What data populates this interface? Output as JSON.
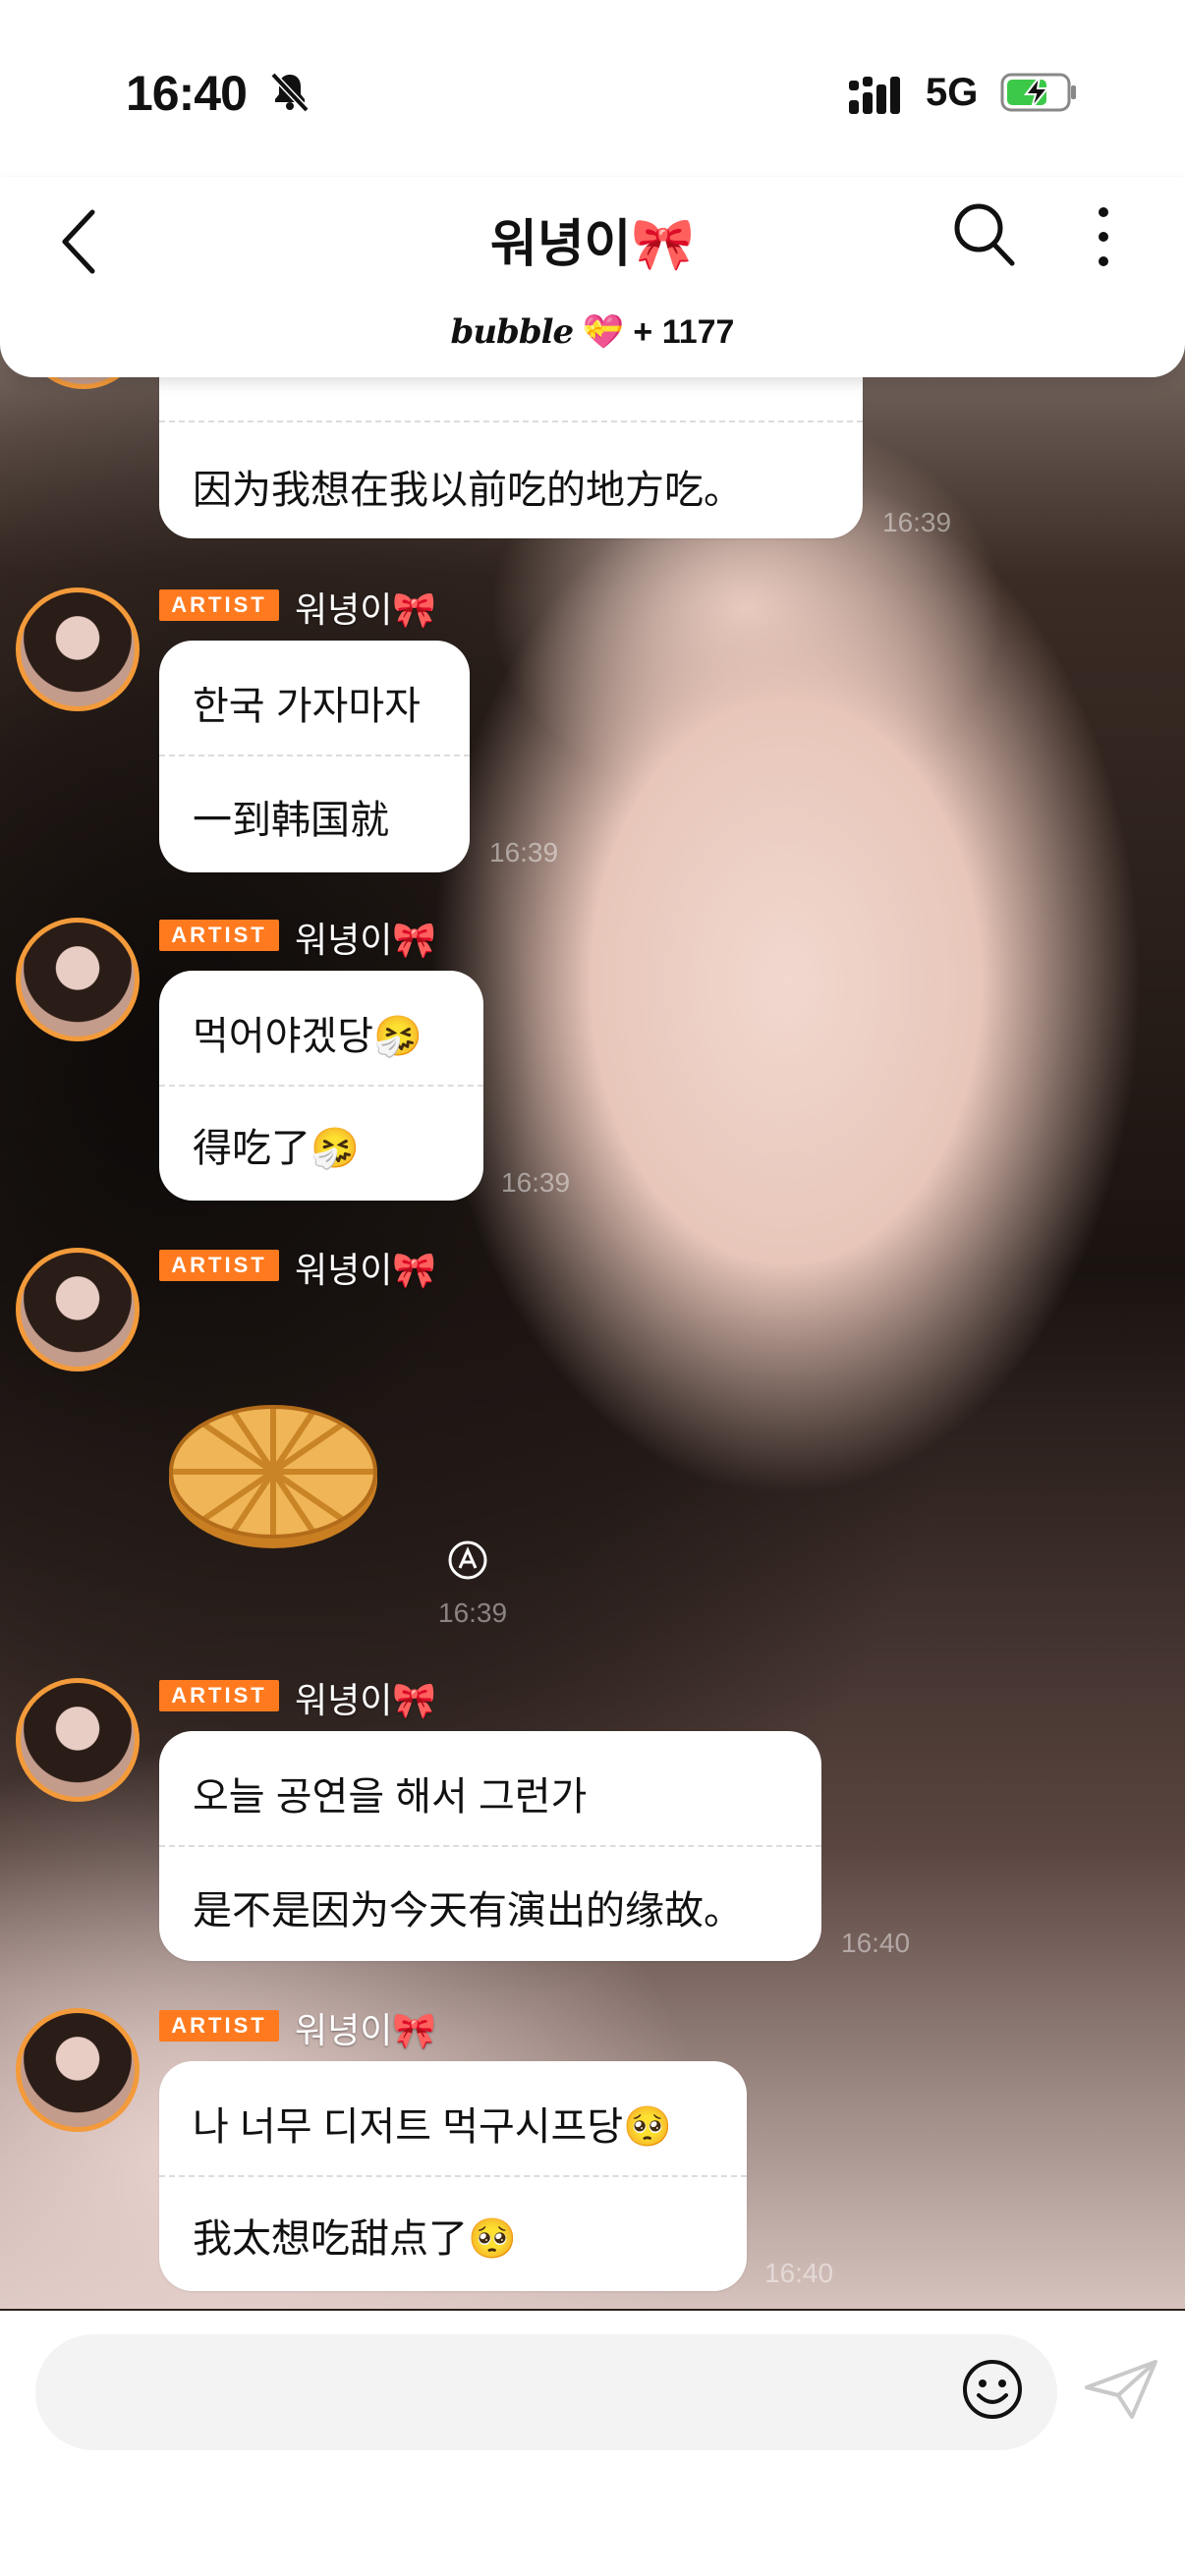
{
  "status": {
    "time": "16:40",
    "network": "5G"
  },
  "header": {
    "title": "워녕이🎀",
    "bubble_label": "bubble",
    "bubble_heart": "💝",
    "bubble_count": "+ 1177"
  },
  "messages": [
    {
      "lines": [
        "",
        "因为我想在我以前吃的地方吃。"
      ],
      "time": "16:39"
    },
    {
      "badge": "ARTIST",
      "sender": "워녕이🎀",
      "lines": [
        "한국 가자마자",
        "一到韩国就"
      ],
      "time": "16:39"
    },
    {
      "badge": "ARTIST",
      "sender": "워녕이🎀",
      "lines": [
        "먹어야겠당🤧",
        "得吃了🤧"
      ],
      "time": "16:39"
    },
    {
      "badge": "ARTIST",
      "sender": "워녕이🎀",
      "sticker": "waffle",
      "time": "16:39"
    },
    {
      "badge": "ARTIST",
      "sender": "워녕이🎀",
      "lines": [
        "오늘 공연을 해서 그런가",
        "是不是因为今天有演出的缘故。"
      ],
      "time": "16:40"
    },
    {
      "badge": "ARTIST",
      "sender": "워녕이🎀",
      "lines": [
        "나 너무 디저트 먹구시프당🥺",
        "我太想吃甜点了🥺"
      ],
      "time": "16:40"
    }
  ],
  "input": {
    "placeholder": ""
  },
  "colors": {
    "accent": "#ff7a1f",
    "avatar_ring": "#f39a3a",
    "battery_green": "#3cc94a"
  }
}
